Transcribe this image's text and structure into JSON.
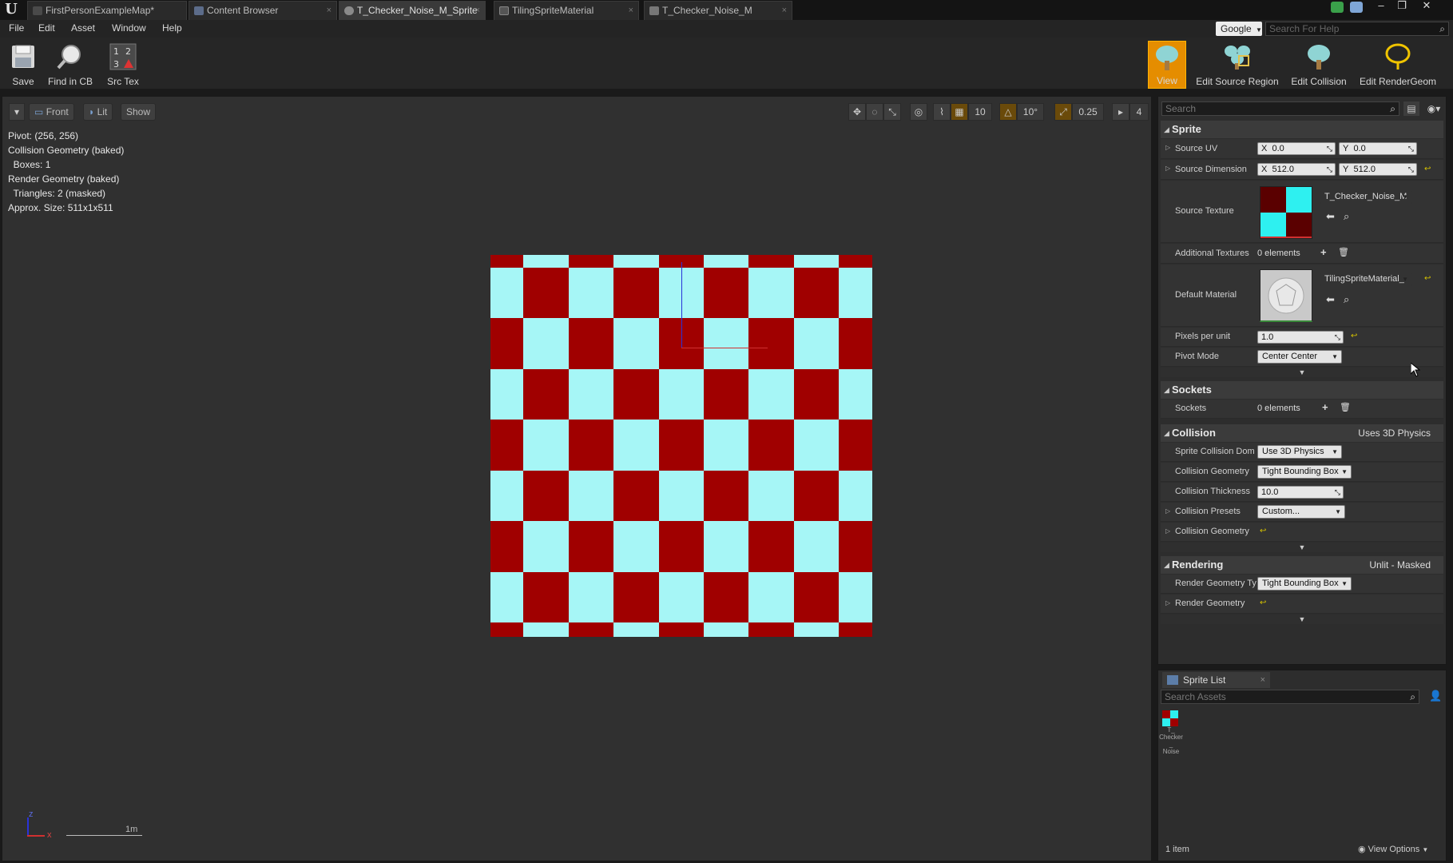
{
  "tabs": [
    {
      "label": "FirstPersonExampleMap*",
      "icon": "map-icon"
    },
    {
      "label": "Content Browser",
      "icon": "content-browser-icon"
    },
    {
      "label": "T_Checker_Noise_M_Sprite",
      "icon": "sprite-icon"
    },
    {
      "label": "TilingSpriteMaterial",
      "icon": "material-icon"
    },
    {
      "label": "T_Checker_Noise_M",
      "icon": "texture-icon"
    }
  ],
  "menu": [
    "File",
    "Edit",
    "Asset",
    "Window",
    "Help"
  ],
  "help_search": {
    "engine": "Google",
    "placeholder": "Search For Help"
  },
  "toolbar": {
    "left": [
      {
        "label": "Save",
        "icon": "save-icon"
      },
      {
        "label": "Find in CB",
        "icon": "find-in-cb-icon"
      },
      {
        "label": "Src Tex",
        "icon": "source-texture-icon"
      }
    ],
    "right": [
      {
        "label": "View",
        "icon": "view-tree-icon",
        "active": true
      },
      {
        "label": "Edit Source Region",
        "icon": "edit-source-region-icon"
      },
      {
        "label": "Edit Collision",
        "icon": "edit-collision-icon"
      },
      {
        "label": "Edit RenderGeom",
        "icon": "edit-rendergeom-icon"
      }
    ]
  },
  "viewport": {
    "buttons": {
      "view_mode": "Front",
      "lighting": "Lit",
      "show": "Show"
    },
    "snap": {
      "grid": "10",
      "rotation": "10°",
      "scale": "0.25",
      "camera_speed": "4"
    },
    "stats": [
      "Pivot: (256, 256)",
      "Collision Geometry (baked)",
      "  Boxes: 1",
      "Render Geometry (baked)",
      "  Triangles: 2 (masked)",
      "Approx. Size: 511x1x511"
    ],
    "scale_label": "1m",
    "axis": {
      "z": "z",
      "x": "x"
    },
    "checker_colors": {
      "dark": "#a00000",
      "light": "#a6f6f6"
    }
  },
  "details": {
    "search_placeholder": "Search",
    "sprite": {
      "header": "Sprite",
      "source_uv": {
        "label": "Source UV",
        "x": "0.0",
        "y": "0.0"
      },
      "source_dimension": {
        "label": "Source Dimension",
        "x": "512.0",
        "y": "512.0"
      },
      "source_texture": {
        "label": "Source Texture",
        "value": "T_Checker_Noise_M"
      },
      "additional_textures": {
        "label": "Additional Textures",
        "value": "0 elements"
      },
      "default_material": {
        "label": "Default Material",
        "value": "TilingSpriteMaterial_"
      },
      "pixels_per_unit": {
        "label": "Pixels per unit",
        "value": "1.0"
      },
      "pivot_mode": {
        "label": "Pivot Mode",
        "value": "Center Center"
      }
    },
    "sockets": {
      "header": "Sockets",
      "label": "Sockets",
      "value": "0 elements"
    },
    "collision": {
      "header": "Collision",
      "header_value": "Uses 3D Physics",
      "domain": {
        "label": "Sprite Collision Dom",
        "value": "Use 3D Physics"
      },
      "geometry_type": {
        "label": "Collision Geometry",
        "value": "Tight Bounding Box"
      },
      "thickness": {
        "label": "Collision Thickness",
        "value": "10.0"
      },
      "presets": {
        "label": "Collision Presets",
        "value": "Custom..."
      },
      "geometry": {
        "label": "Collision Geometry"
      }
    },
    "rendering": {
      "header": "Rendering",
      "header_value": "Unlit - Masked",
      "geometry_type": {
        "label": "Render Geometry Ty",
        "value": "Tight Bounding Box"
      },
      "geometry": {
        "label": "Render Geometry"
      }
    }
  },
  "sprite_list": {
    "tab": "Sprite List",
    "search_placeholder": "Search Assets",
    "asset_label_1": "T_",
    "asset_label_2": "Checker",
    "asset_label_3": "_",
    "asset_label_4": "Noise",
    "count": "1 item",
    "view_options": "View Options"
  }
}
